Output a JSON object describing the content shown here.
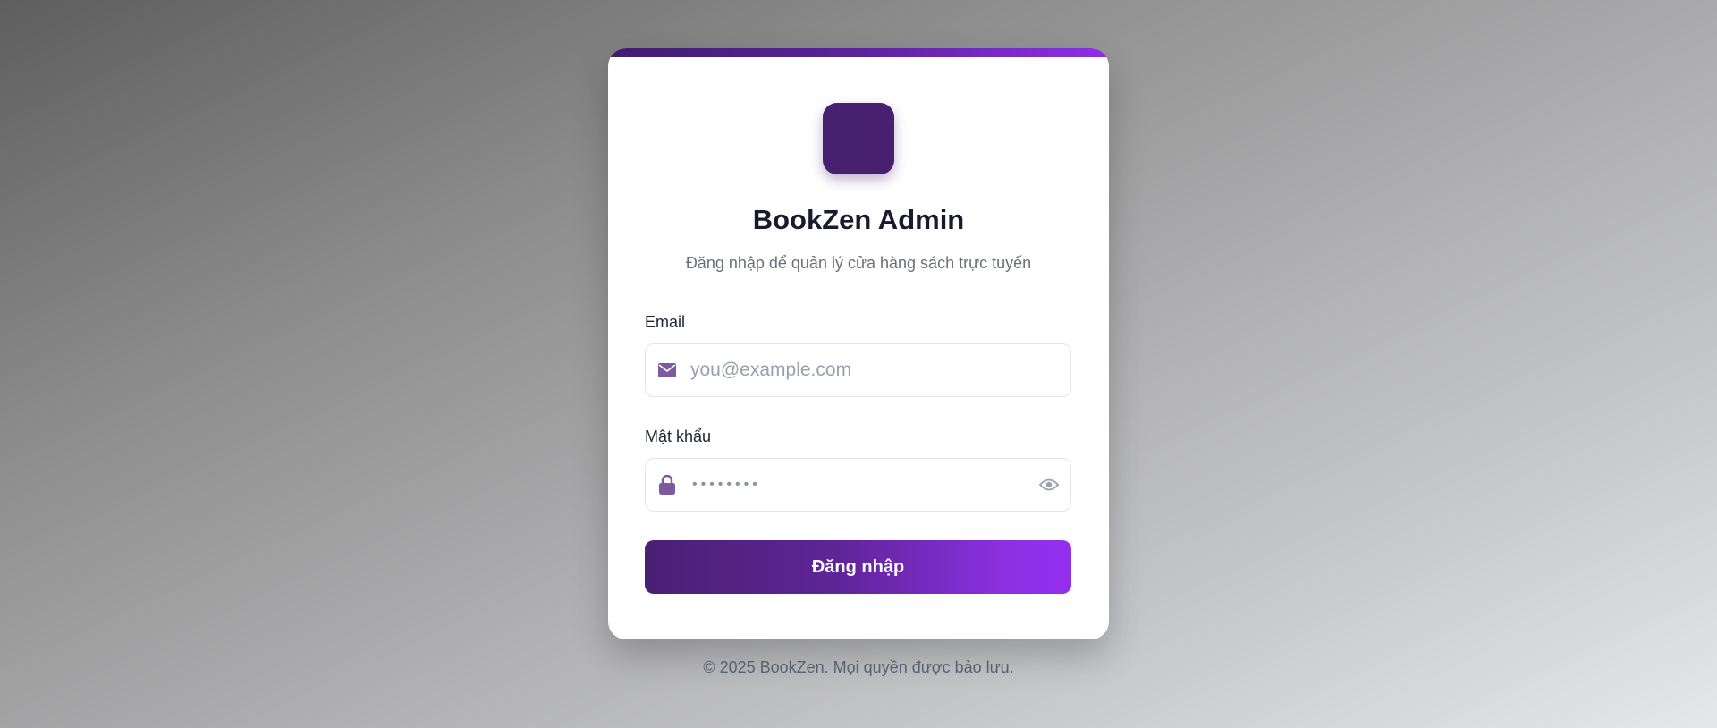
{
  "brand": {
    "title": "BookZen Admin",
    "subtitle": "Đăng nhập để quản lý cửa hàng sách trực tuyến",
    "logo_color": "#472170",
    "accent_gradient": [
      "#4a2072",
      "#932ff0"
    ]
  },
  "form": {
    "email_label": "Email",
    "email_placeholder": "you@example.com",
    "email_value": "",
    "email_icon": "envelope-icon",
    "password_label": "Mật khẩu",
    "password_masked": "••••••••",
    "password_icon": "lock-icon",
    "show_password_icon": "eye-icon",
    "submit_label": "Đăng nhập"
  },
  "footer": {
    "text": "© 2025 BookZen. Mọi quyền được bảo lưu."
  }
}
